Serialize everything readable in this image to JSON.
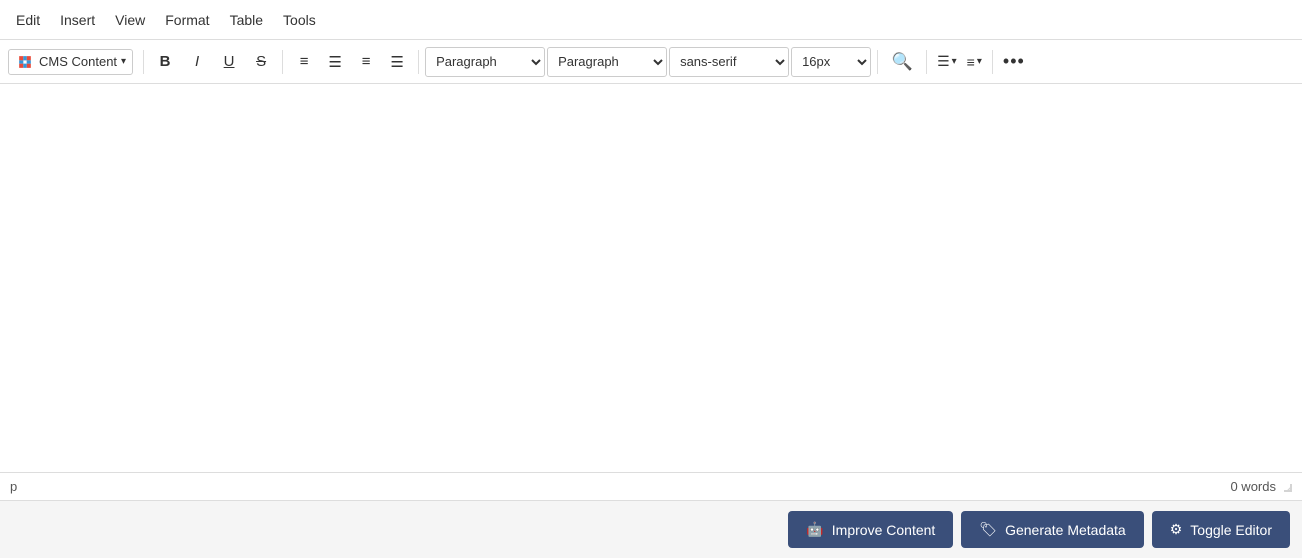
{
  "menubar": {
    "items": [
      {
        "label": "Edit",
        "name": "edit-menu"
      },
      {
        "label": "Insert",
        "name": "insert-menu"
      },
      {
        "label": "View",
        "name": "view-menu"
      },
      {
        "label": "Format",
        "name": "format-menu"
      },
      {
        "label": "Table",
        "name": "table-menu"
      },
      {
        "label": "Tools",
        "name": "tools-menu"
      }
    ]
  },
  "toolbar": {
    "logo_label": "CMS Content",
    "bold_label": "B",
    "italic_label": "I",
    "underline_label": "U",
    "strikethrough_label": "S",
    "paragraph_select1": "Paragraph",
    "paragraph_select2": "Paragraph",
    "font_select": "sans-serif",
    "size_select": "16px"
  },
  "editor": {
    "content": ""
  },
  "statusbar": {
    "element": "p",
    "word_count": "0 words"
  },
  "actionbar": {
    "improve_label": "Improve Content",
    "metadata_label": "Generate Metadata",
    "toggle_label": "Toggle Editor"
  }
}
